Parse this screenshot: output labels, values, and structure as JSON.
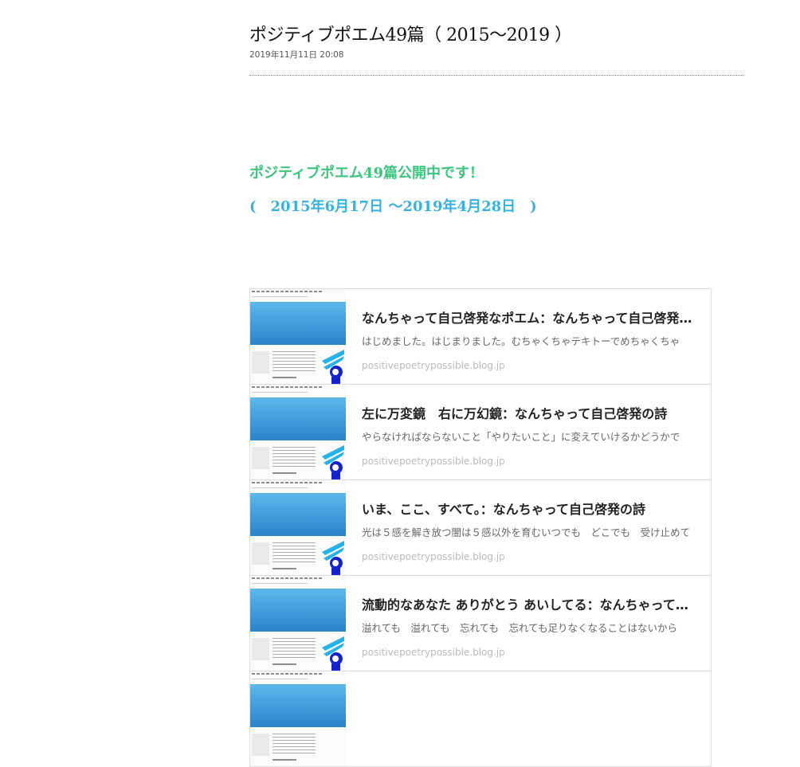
{
  "article": {
    "title": "ポジティブポエム49篇（ 2015～2019 ）",
    "date": "2019年11月11日 20:08"
  },
  "lead": {
    "line1": "ポジティブポエム49篇公開中です！",
    "line2": "(　2015年6月17日 ～2019年4月28日　)"
  },
  "colors": {
    "lead1": "#3ec47e",
    "lead2": "#38b2dd",
    "thumb_banner": "#3a9ad8"
  },
  "cards": [
    {
      "title": "なんちゃって自己啓発なポエム：なんちゃって自己啓発の詩",
      "description": "はじめました。はじまりました。むちゃくちゃテキトーでめちゃくちゃ",
      "domain": "positivepoetrypossible.blog.jp"
    },
    {
      "title": "左に万変鏡　右に万幻鏡：なんちゃって自己啓発の詩",
      "description": "やらなければならないこと「やりたいこと」に変えていけるかどうかで",
      "domain": "positivepoetrypossible.blog.jp"
    },
    {
      "title": "いま、ここ、すべて。：なんちゃって自己啓発の詩",
      "description": "光は５感を解き放つ闇は５感以外を育むいつでも　どこでも　受け止めて",
      "domain": "positivepoetrypossible.blog.jp"
    },
    {
      "title": "流動的なあなた ありがとう あいしてる：なんちゃって自己啓発の詩",
      "description": "溢れても　溢れても　忘れても　忘れても足りなくなることはないから",
      "domain": "positivepoetrypossible.blog.jp"
    },
    {
      "title": "",
      "description": "",
      "domain": ""
    }
  ]
}
